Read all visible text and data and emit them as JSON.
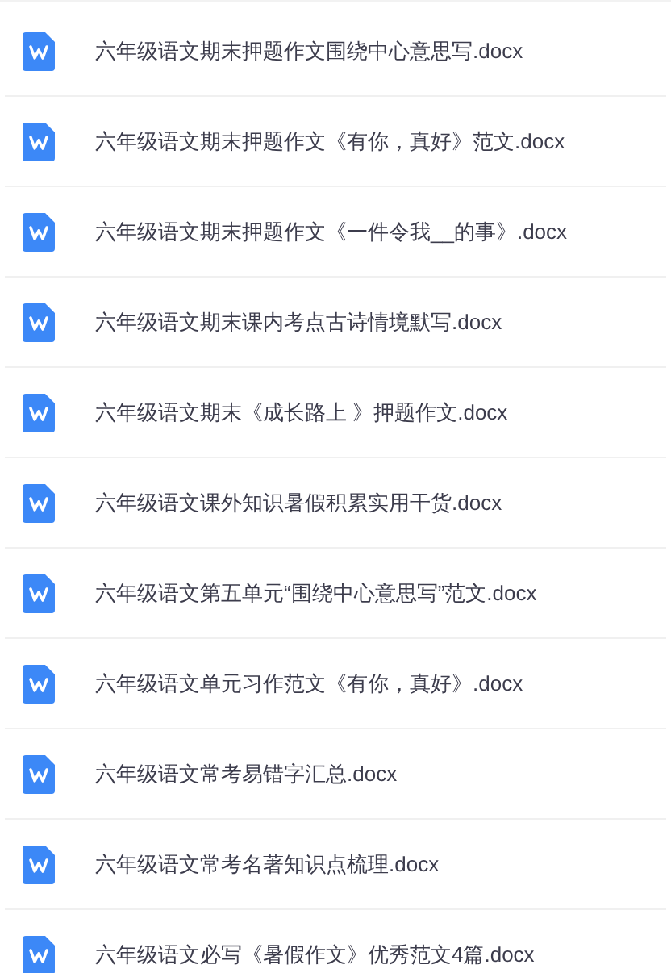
{
  "files": [
    {
      "name": "六年级语文期末押题作文围绕中心意思写.docx"
    },
    {
      "name": "六年级语文期末押题作文《有你，真好》范文.docx"
    },
    {
      "name": "六年级语文期末押题作文《一件令我__的事》.docx"
    },
    {
      "name": "六年级语文期末课内考点古诗情境默写.docx"
    },
    {
      "name": "六年级语文期末《成长路上 》押题作文.docx"
    },
    {
      "name": "六年级语文课外知识暑假积累实用干货.docx"
    },
    {
      "name": "六年级语文第五单元“围绕中心意思写”范文.docx"
    },
    {
      "name": "六年级语文单元习作范文《有你，真好》.docx"
    },
    {
      "name": "六年级语文常考易错字汇总.docx"
    },
    {
      "name": "六年级语文常考名著知识点梳理.docx"
    },
    {
      "name": "六年级语文必写《暑假作文》优秀范文4篇.docx"
    }
  ]
}
